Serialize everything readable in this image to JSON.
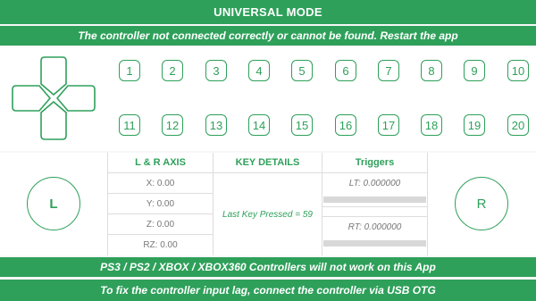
{
  "app": {
    "title": "UNIVERSAL MODE",
    "error_message": "The controller not connected correctly or cannot be found. Restart the app",
    "warning": "PS3 / PS2 / XBOX / XBOX360 Controllers will not work on this App",
    "tip": "To fix the controller input lag, connect the controller via USB OTG"
  },
  "colors": {
    "accent": "#2ea05a",
    "panel": "#ffffff",
    "background": "#f7f7f7"
  },
  "buttons": [
    "1",
    "2",
    "3",
    "4",
    "5",
    "6",
    "7",
    "8",
    "9",
    "10",
    "11",
    "12",
    "13",
    "14",
    "15",
    "16",
    "17",
    "18",
    "19",
    "20"
  ],
  "sticks": {
    "left": "L",
    "right": "R"
  },
  "axis": {
    "header": "L & R AXIS",
    "x": "X: 0.00",
    "y": "Y: 0.00",
    "z": "Z: 0.00",
    "rz": "RZ: 0.00"
  },
  "key_details": {
    "header": "KEY DETAILS",
    "last_key": "Last Key Pressed = 59"
  },
  "triggers": {
    "header": "Triggers",
    "lt": "LT: 0.000000",
    "rt": "RT: 0.000000",
    "lt_level": 0,
    "rt_level": 0
  }
}
